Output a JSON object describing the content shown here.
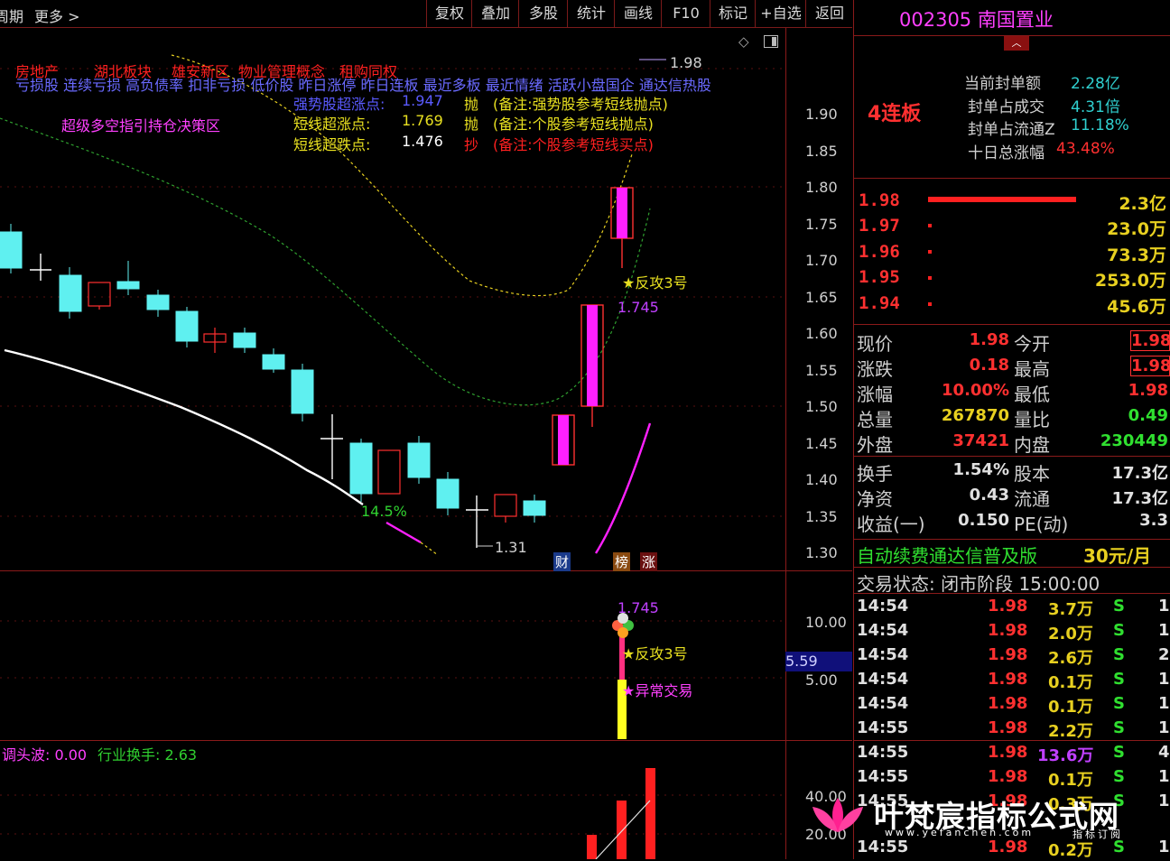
{
  "toolbar": {
    "left_items": [
      "周期",
      "更多 >"
    ],
    "buttons": [
      "复权",
      "叠加",
      "多股",
      "统计",
      "画线",
      "F10",
      "标记",
      "+自选",
      "返回"
    ]
  },
  "chart": {
    "tags_row1": [
      "房地产",
      "湖北板块",
      "雄安新区",
      "物业管理概念",
      "租购同权"
    ],
    "tags_row2": "亏损股 连续亏损 高负债率 扣非亏损 低价股 昨日涨停 昨日连板 最近多板 最近情绪 活跃小盘国企 通达信热股",
    "strategy_title": "超级多空指引持仓决策区",
    "signals": [
      {
        "name": "强势股超涨点:",
        "value": "1.947",
        "action": "抛",
        "note": "(备注:强势股参考短线抛点)"
      },
      {
        "name": "短线超涨点:",
        "value": "1.769",
        "action": "抛",
        "note": "(备注:个股参考短线抛点)"
      },
      {
        "name": "短线超跌点:",
        "value": "1.476",
        "action": "抄",
        "note": "(备注:个股参考短线买点)"
      }
    ],
    "price_axis": [
      "1.90",
      "1.85",
      "1.80",
      "1.75",
      "1.70",
      "1.65",
      "1.60",
      "1.55",
      "1.50",
      "1.45",
      "1.40",
      "1.35",
      "1.30"
    ],
    "high_mark": "1.98",
    "low_mark": "1.31",
    "pct_label": "14.5%",
    "fangong_label": "★反攻3号",
    "level_label": "1.745",
    "badges": [
      "财",
      "榜",
      "涨"
    ],
    "mid_axis": [
      "10.00",
      "5.00"
    ],
    "mid_current": "5.59",
    "mid_level": "1.745",
    "mid_fangong": "★反攻3号",
    "mid_abnormal": "★异常交易",
    "bottom_title": "调头波: 0.00",
    "bottom_ind": "行业换手: 2.63",
    "bottom_axis": [
      "40.00",
      "20.00"
    ],
    "watermark": "叶梵宸指标公式网",
    "watermark_url": "www.yefanchen.com",
    "watermark_sub": "指标订阅"
  },
  "stock": {
    "code_name": "002305 南国置业",
    "limit_label": "4连板",
    "seal": [
      {
        "label": "当前封单额",
        "value": "2.28亿"
      },
      {
        "label": "封单占成交",
        "value": "4.31倍"
      },
      {
        "label": "封单占流通Z",
        "value": "11.18%"
      },
      {
        "label": "十日总涨幅",
        "value": "43.48%"
      }
    ],
    "bids": [
      {
        "price": "1.98",
        "vol": "2.3亿",
        "bar": 1.0
      },
      {
        "price": "1.97",
        "vol": "23.0万",
        "bar": 0.01
      },
      {
        "price": "1.96",
        "vol": "73.3万",
        "bar": 0.01
      },
      {
        "price": "1.95",
        "vol": "253.0万",
        "bar": 0.01
      },
      {
        "price": "1.94",
        "vol": "45.6万",
        "bar": 0.01
      }
    ],
    "quote": [
      {
        "l1": "现价",
        "v1": "1.98",
        "l2": "今开",
        "v2": "1.98"
      },
      {
        "l1": "涨跌",
        "v1": "0.18",
        "l2": "最高",
        "v2": "1.98"
      },
      {
        "l1": "涨幅",
        "v1": "10.00%",
        "l2": "最低",
        "v2": "1.98"
      },
      {
        "l1": "总量",
        "v1": "267870",
        "l2": "量比",
        "v2": "0.49"
      },
      {
        "l1": "外盘",
        "v1": "37421",
        "l2": "内盘",
        "v2": "230449"
      }
    ],
    "fund": [
      {
        "l1": "换手",
        "v1": "1.54%",
        "l2": "股本",
        "v2": "17.3亿"
      },
      {
        "l1": "净资",
        "v1": "0.43",
        "l2": "流通",
        "v2": "17.3亿"
      },
      {
        "l1": "收益(一)",
        "v1": "0.150",
        "l2": "PE(动)",
        "v2": "3.3"
      }
    ],
    "ad": "自动续费通达信普及版",
    "ad_price": "30元/月",
    "trade_status": "交易状态: 闭市阶段 15:00:00",
    "ticks": [
      {
        "time": "14:54",
        "price": "1.98",
        "vol": "3.7万",
        "bs": "S",
        "n": "1"
      },
      {
        "time": "14:54",
        "price": "1.98",
        "vol": "2.0万",
        "bs": "S",
        "n": "1"
      },
      {
        "time": "14:54",
        "price": "1.98",
        "vol": "2.6万",
        "bs": "S",
        "n": "2"
      },
      {
        "time": "14:54",
        "price": "1.98",
        "vol": "0.1万",
        "bs": "S",
        "n": "1"
      },
      {
        "time": "14:54",
        "price": "1.98",
        "vol": "0.1万",
        "bs": "S",
        "n": "1"
      },
      {
        "time": "14:55",
        "price": "1.98",
        "vol": "2.2万",
        "bs": "S",
        "n": "1"
      },
      {
        "time": "14:55",
        "price": "1.98",
        "vol": "13.6万",
        "bs": "S",
        "n": "4"
      },
      {
        "time": "14:55",
        "price": "1.98",
        "vol": "0.1万",
        "bs": "S",
        "n": "1"
      },
      {
        "time": "14:55",
        "price": "1.98",
        "vol": "0.3万",
        "bs": "S",
        "n": "1"
      },
      {
        "time": "14:55",
        "price": "1.98",
        "vol": "0.2万",
        "bs": "S",
        "n": "1"
      }
    ]
  }
}
